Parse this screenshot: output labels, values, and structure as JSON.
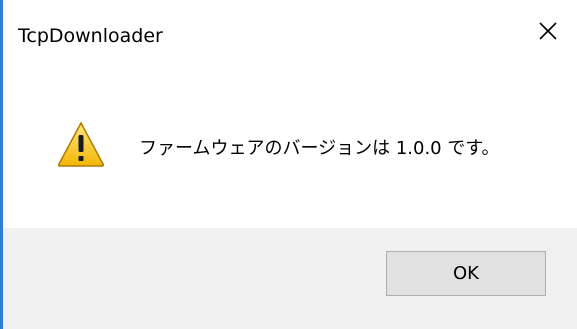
{
  "window": {
    "title": "TcpDownloader",
    "accent_color": "#2d7fd6"
  },
  "titlebar": {
    "close_icon": "close-icon"
  },
  "content": {
    "icon": "warning-icon",
    "message": "ファームウェアのバージョンは 1.0.0 です。"
  },
  "footer": {
    "ok_label": "OK"
  }
}
